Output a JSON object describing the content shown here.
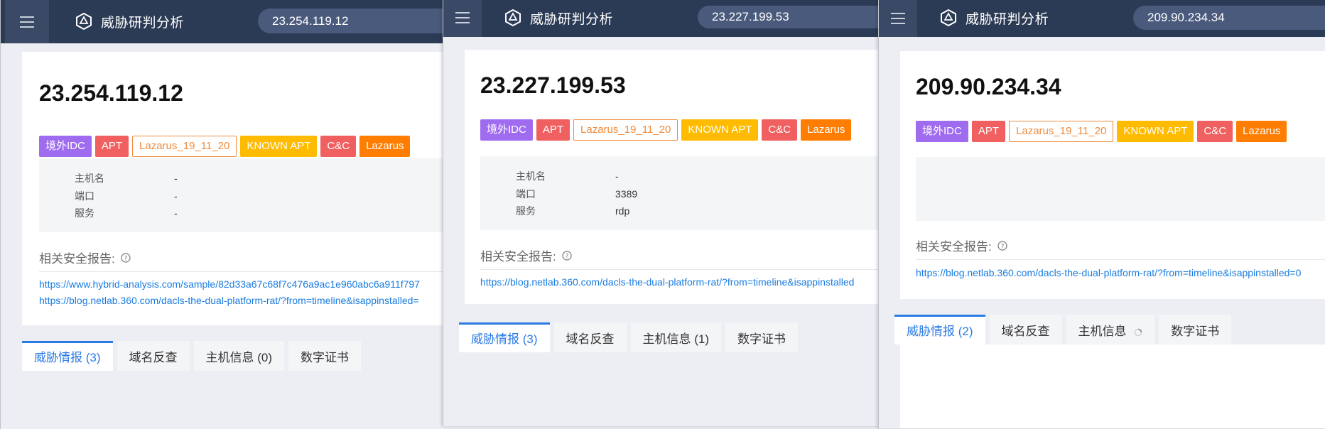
{
  "app_title": "威胁研判分析",
  "panels": [
    {
      "search_ip": "23.254.119.12",
      "ip": "23.254.119.12",
      "tags": [
        "境外IDC",
        "APT",
        "Lazarus_19_11_20",
        "KNOWN APT",
        "C&C",
        "Lazarus"
      ],
      "info": {
        "hostname_label": "主机名",
        "hostname": "-",
        "port_label": "端口",
        "port": "-",
        "service_label": "服务",
        "service": "-"
      },
      "report_title": "相关安全报告:",
      "links": [
        "https://www.hybrid-analysis.com/sample/82d33a67c68f7c476a9ac1e960abc6a911f797",
        "https://blog.netlab.360.com/dacls-the-dual-platform-rat/?from=timeline&isappinstalled="
      ],
      "tabs": [
        "威胁情报 (3)",
        "域名反查",
        "主机信息 (0)",
        "数字证书"
      ]
    },
    {
      "search_ip": "23.227.199.53",
      "ip": "23.227.199.53",
      "tags": [
        "境外IDC",
        "APT",
        "Lazarus_19_11_20",
        "KNOWN APT",
        "C&C",
        "Lazarus"
      ],
      "info": {
        "hostname_label": "主机名",
        "hostname": "-",
        "port_label": "端口",
        "port": "3389",
        "service_label": "服务",
        "service": "rdp"
      },
      "report_title": "相关安全报告:",
      "links": [
        "https://blog.netlab.360.com/dacls-the-dual-platform-rat/?from=timeline&isappinstalled"
      ],
      "tabs": [
        "威胁情报 (3)",
        "域名反查",
        "主机信息 (1)",
        "数字证书"
      ]
    },
    {
      "search_ip": "209.90.234.34",
      "ip": "209.90.234.34",
      "tags": [
        "境外IDC",
        "APT",
        "Lazarus_19_11_20",
        "KNOWN APT",
        "C&C",
        "Lazarus"
      ],
      "report_title": "相关安全报告:",
      "links": [
        "https://blog.netlab.360.com/dacls-the-dual-platform-rat/?from=timeline&isappinstalled=0"
      ],
      "tabs": [
        "威胁情报 (2)",
        "域名反查",
        "主机信息",
        "数字证书"
      ]
    }
  ],
  "colors": {
    "topbar": "#2c3b55",
    "accent": "#2a7be4",
    "tag_idc": "#9f6cf0",
    "tag_apt": "#f06060",
    "tag_known_apt": "#ffbb00",
    "tag_lazarus": "#ff7d00",
    "link": "#1a7ce0"
  },
  "icons": {
    "menu": "hamburger-icon",
    "logo": "shield-logo-icon",
    "help": "question-circle-icon",
    "loading": "spinner-icon"
  }
}
